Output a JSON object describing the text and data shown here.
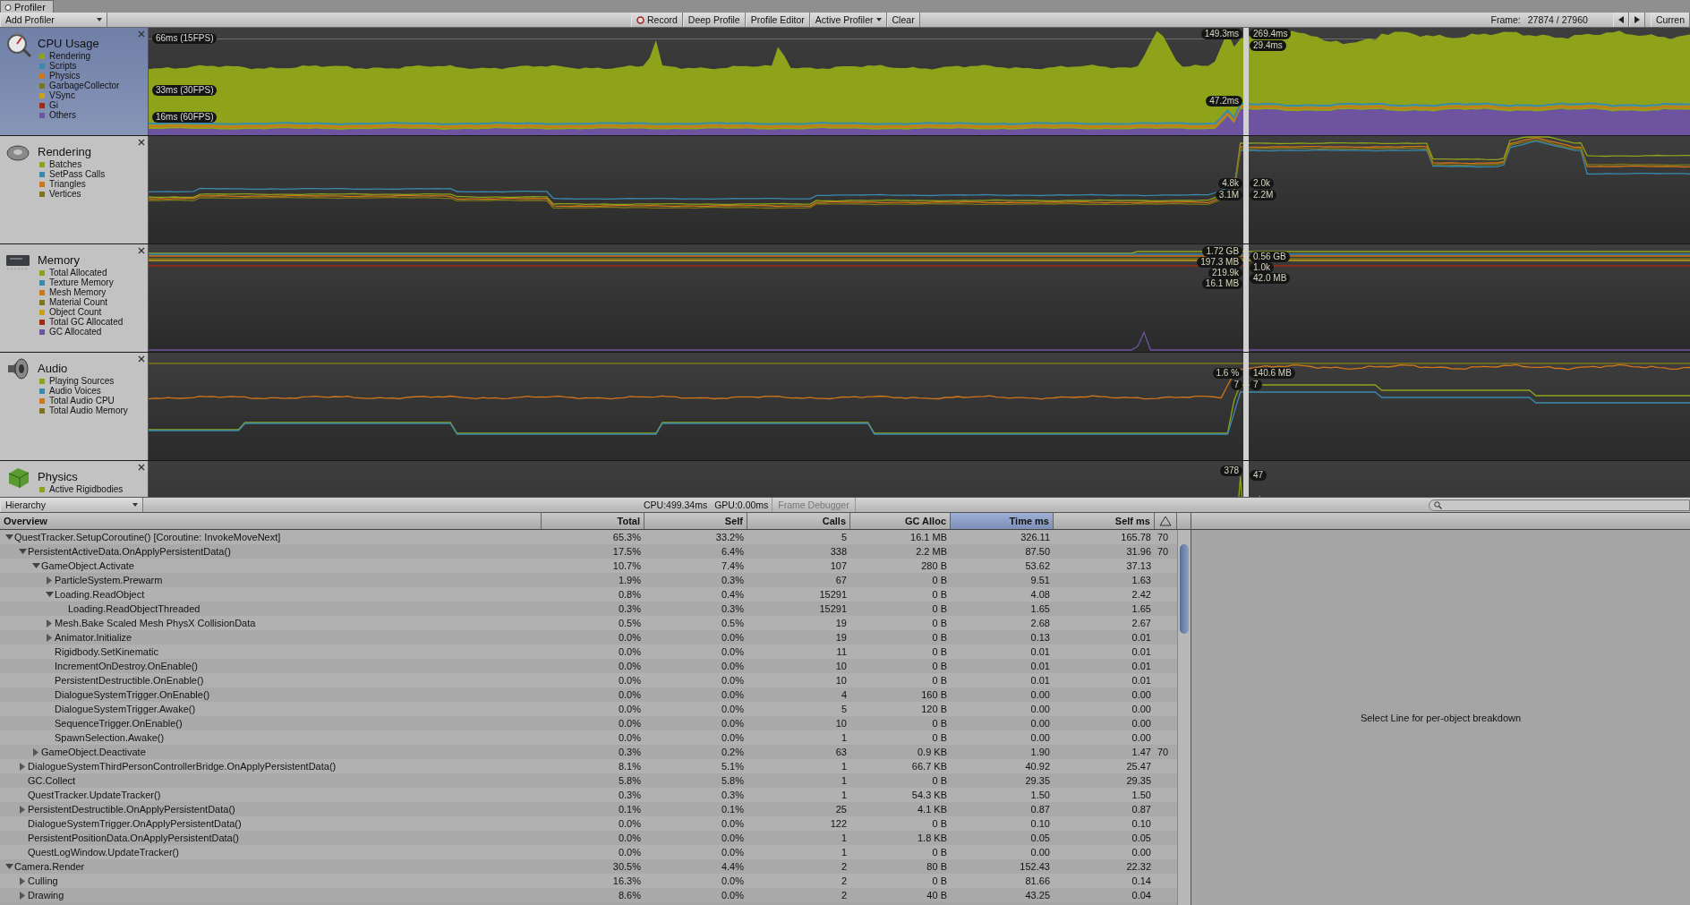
{
  "window": {
    "title": "Profiler"
  },
  "toolbar": {
    "add_profiler": "Add Profiler",
    "buttons": [
      {
        "label": "Record",
        "kind": "record"
      },
      {
        "label": "Deep Profile",
        "kind": "plain"
      },
      {
        "label": "Profile Editor",
        "kind": "plain"
      },
      {
        "label": "Active Profiler",
        "kind": "dropdown"
      },
      {
        "label": "Clear",
        "kind": "plain"
      }
    ],
    "frame_label": "Frame:",
    "frame_value": "27874 / 27960",
    "current": "Curren"
  },
  "modules": [
    {
      "name": "CPU Usage",
      "selected": true,
      "kind": "area",
      "legend": [
        {
          "label": "Rendering",
          "color": "#8ea31a"
        },
        {
          "label": "Scripts",
          "color": "#3a8ab0"
        },
        {
          "label": "Physics",
          "color": "#d0761a"
        },
        {
          "label": "GarbageCollector",
          "color": "#7d7517"
        },
        {
          "label": "VSync",
          "color": "#c9a01a"
        },
        {
          "label": "Gi",
          "color": "#a02a10"
        },
        {
          "label": "Others",
          "color": "#6e54a0"
        }
      ],
      "grid_labels": [
        "66ms (15FPS)",
        "33ms (30FPS)",
        "16ms (60FPS)"
      ],
      "left_values": [
        "149.3ms",
        "47.2ms"
      ],
      "right_values": [
        "269.4ms",
        "29.4ms"
      ]
    },
    {
      "name": "Rendering",
      "selected": false,
      "kind": "line",
      "legend": [
        {
          "label": "Batches",
          "color": "#8ea31a"
        },
        {
          "label": "SetPass Calls",
          "color": "#3a8ab0"
        },
        {
          "label": "Triangles",
          "color": "#d0761a"
        },
        {
          "label": "Vertices",
          "color": "#7d7517"
        }
      ],
      "left_values": [
        "4.8k",
        "3.1M"
      ],
      "right_values": [
        "2.0k",
        "2.2M"
      ]
    },
    {
      "name": "Memory",
      "selected": false,
      "kind": "line",
      "legend": [
        {
          "label": "Total Allocated",
          "color": "#8ea31a"
        },
        {
          "label": "Texture Memory",
          "color": "#3a8ab0"
        },
        {
          "label": "Mesh Memory",
          "color": "#d0761a"
        },
        {
          "label": "Material Count",
          "color": "#7d7517"
        },
        {
          "label": "Object Count",
          "color": "#c9a01a"
        },
        {
          "label": "Total GC Allocated",
          "color": "#a02a10"
        },
        {
          "label": "GC Allocated",
          "color": "#6e54a0"
        }
      ],
      "left_values": [
        "1.72 GB",
        "197.3 MB",
        "219.9k",
        "16.1 MB"
      ],
      "right_values": [
        "0.56 GB",
        "1.0k",
        "42.0 MB"
      ]
    },
    {
      "name": "Audio",
      "selected": false,
      "kind": "line",
      "legend": [
        {
          "label": "Playing Sources",
          "color": "#8ea31a"
        },
        {
          "label": "Audio Voices",
          "color": "#3a8ab0"
        },
        {
          "label": "Total Audio CPU",
          "color": "#d0761a"
        },
        {
          "label": "Total Audio Memory",
          "color": "#7d7517"
        }
      ],
      "left_values": [
        "1.6 %",
        "7"
      ],
      "right_values": [
        "140.6 MB",
        "7"
      ]
    },
    {
      "name": "Physics",
      "selected": false,
      "kind": "line",
      "legend": [
        {
          "label": "Active Rigidbodies",
          "color": "#8ea31a"
        }
      ],
      "left_values": [
        "378"
      ],
      "right_values": [
        "47"
      ]
    }
  ],
  "detail_toolbar": {
    "view": "Hierarchy",
    "cpu": "CPU:499.34ms",
    "gpu": "GPU:0.00ms",
    "frame_debugger": {
      "label": "Frame Debugger",
      "disabled": true
    }
  },
  "table": {
    "columns": [
      {
        "label": "Overview",
        "selected": false
      },
      {
        "label": "Total",
        "selected": false
      },
      {
        "label": "Self",
        "selected": false
      },
      {
        "label": "Calls",
        "selected": false
      },
      {
        "label": "GC Alloc",
        "selected": false
      },
      {
        "label": "Time ms",
        "selected": true
      },
      {
        "label": "Self ms",
        "selected": false
      }
    ],
    "rows": [
      {
        "name": "QuestTracker.SetupCoroutine() [Coroutine: InvokeMoveNext]",
        "values": [
          "65.3%",
          "33.2%",
          "5",
          "16.1 MB",
          "326.11",
          "165.78"
        ],
        "warnings": "70",
        "expanded": true,
        "children": [
          {
            "name": "PersistentActiveData.OnApplyPersistentData()",
            "values": [
              "17.5%",
              "6.4%",
              "338",
              "2.2 MB",
              "87.50",
              "31.96"
            ],
            "warnings": "70",
            "expanded": true,
            "children": [
              {
                "name": "GameObject.Activate",
                "values": [
                  "10.7%",
                  "7.4%",
                  "107",
                  "280 B",
                  "53.62",
                  "37.13"
                ],
                "expanded": true,
                "children": [
                  {
                    "name": "ParticleSystem.Prewarm",
                    "values": [
                      "1.9%",
                      "0.3%",
                      "67",
                      "0 B",
                      "9.51",
                      "1.63"
                    ],
                    "expanded": false
                  },
                  {
                    "name": "Loading.ReadObject",
                    "values": [
                      "0.8%",
                      "0.4%",
                      "15291",
                      "0 B",
                      "4.08",
                      "2.42"
                    ],
                    "expanded": true,
                    "children": [
                      {
                        "name": "Loading.ReadObjectThreaded",
                        "values": [
                          "0.3%",
                          "0.3%",
                          "15291",
                          "0 B",
                          "1.65",
                          "1.65"
                        ]
                      }
                    ]
                  },
                  {
                    "name": "Mesh.Bake Scaled Mesh PhysX CollisionData",
                    "values": [
                      "0.5%",
                      "0.5%",
                      "19",
                      "0 B",
                      "2.68",
                      "2.67"
                    ],
                    "expanded": false
                  },
                  {
                    "name": "Animator.Initialize",
                    "values": [
                      "0.0%",
                      "0.0%",
                      "19",
                      "0 B",
                      "0.13",
                      "0.01"
                    ],
                    "expanded": false
                  },
                  {
                    "name": "Rigidbody.SetKinematic",
                    "values": [
                      "0.0%",
                      "0.0%",
                      "11",
                      "0 B",
                      "0.01",
                      "0.01"
                    ]
                  },
                  {
                    "name": "IncrementOnDestroy.OnEnable()",
                    "values": [
                      "0.0%",
                      "0.0%",
                      "10",
                      "0 B",
                      "0.01",
                      "0.01"
                    ]
                  },
                  {
                    "name": "PersistentDestructible.OnEnable()",
                    "values": [
                      "0.0%",
                      "0.0%",
                      "10",
                      "0 B",
                      "0.01",
                      "0.01"
                    ]
                  },
                  {
                    "name": "DialogueSystemTrigger.OnEnable()",
                    "values": [
                      "0.0%",
                      "0.0%",
                      "4",
                      "160 B",
                      "0.00",
                      "0.00"
                    ]
                  },
                  {
                    "name": "DialogueSystemTrigger.Awake()",
                    "values": [
                      "0.0%",
                      "0.0%",
                      "5",
                      "120 B",
                      "0.00",
                      "0.00"
                    ]
                  },
                  {
                    "name": "SequenceTrigger.OnEnable()",
                    "values": [
                      "0.0%",
                      "0.0%",
                      "10",
                      "0 B",
                      "0.00",
                      "0.00"
                    ]
                  },
                  {
                    "name": "SpawnSelection.Awake()",
                    "values": [
                      "0.0%",
                      "0.0%",
                      "1",
                      "0 B",
                      "0.00",
                      "0.00"
                    ]
                  }
                ]
              },
              {
                "name": "GameObject.Deactivate",
                "values": [
                  "0.3%",
                  "0.2%",
                  "63",
                  "0.9 KB",
                  "1.90",
                  "1.47"
                ],
                "warnings": "70",
                "expanded": false
              }
            ]
          },
          {
            "name": "DialogueSystemThirdPersonControllerBridge.OnApplyPersistentData()",
            "values": [
              "8.1%",
              "5.1%",
              "1",
              "66.7 KB",
              "40.92",
              "25.47"
            ],
            "expanded": false
          },
          {
            "name": "GC.Collect",
            "values": [
              "5.8%",
              "5.8%",
              "1",
              "0 B",
              "29.35",
              "29.35"
            ]
          },
          {
            "name": "QuestTracker.UpdateTracker()",
            "values": [
              "0.3%",
              "0.3%",
              "1",
              "54.3 KB",
              "1.50",
              "1.50"
            ]
          },
          {
            "name": "PersistentDestructible.OnApplyPersistentData()",
            "values": [
              "0.1%",
              "0.1%",
              "25",
              "4.1 KB",
              "0.87",
              "0.87"
            ],
            "expanded": false
          },
          {
            "name": "DialogueSystemTrigger.OnApplyPersistentData()",
            "values": [
              "0.0%",
              "0.0%",
              "122",
              "0 B",
              "0.10",
              "0.10"
            ]
          },
          {
            "name": "PersistentPositionData.OnApplyPersistentData()",
            "values": [
              "0.0%",
              "0.0%",
              "1",
              "1.8 KB",
              "0.05",
              "0.05"
            ]
          },
          {
            "name": "QuestLogWindow.UpdateTracker()",
            "values": [
              "0.0%",
              "0.0%",
              "1",
              "0 B",
              "0.00",
              "0.00"
            ]
          }
        ]
      },
      {
        "name": "Camera.Render",
        "values": [
          "30.5%",
          "4.4%",
          "2",
          "80 B",
          "152.43",
          "22.32"
        ],
        "expanded": true,
        "children": [
          {
            "name": "Culling",
            "values": [
              "16.3%",
              "0.0%",
              "2",
              "0 B",
              "81.66",
              "0.14"
            ],
            "expanded": false
          },
          {
            "name": "Drawing",
            "values": [
              "8.6%",
              "0.0%",
              "2",
              "40 B",
              "43.25",
              "0.04"
            ],
            "expanded": false
          }
        ]
      }
    ]
  },
  "details": {
    "message": "Select Line for per-object breakdown"
  }
}
